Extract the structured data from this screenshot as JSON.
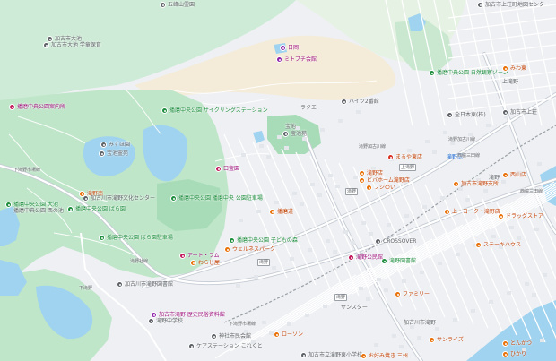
{
  "map": {
    "colors": {
      "park": "#b7e4c7",
      "forest": "#cdebd6",
      "water": "#9fd3f0",
      "urban": "#f1f3f4",
      "road": "#ffffff",
      "major_road": "#c3ccd6",
      "land_beige": "#f4ecd9"
    },
    "labels": [
      {
        "text": "五峰山霊園",
        "color": "gray",
        "pin": "gray"
      },
      {
        "text": "加古市上荘町地図センター",
        "color": "gray",
        "pin": "gray"
      },
      {
        "text": "加古市大池",
        "color": "gray",
        "pin": "gray"
      },
      {
        "text": "加古市大池 学童保育",
        "color": "gray",
        "pin": "gray"
      },
      {
        "text": "日岡",
        "color": "pink",
        "pin": "purple"
      },
      {
        "text": "ミトブチ会館",
        "color": "pink",
        "pin": "purple"
      },
      {
        "text": "播磨中央公園 自然観察ゾーン",
        "color": "green",
        "pin": "green"
      },
      {
        "text": "みわ東",
        "color": "orange",
        "pin": "orange"
      },
      {
        "text": "上滝野",
        "color": "gray",
        "pin": null
      },
      {
        "text": "播磨中央公園案内所",
        "color": "pink",
        "pin": "pink"
      },
      {
        "text": "播磨中央公園 サイクリングステーション",
        "color": "green",
        "pin": "green"
      },
      {
        "text": "ハイツ2番館",
        "color": "gray",
        "pin": "gray"
      },
      {
        "text": "ラクエ",
        "color": "gray",
        "pin": null
      },
      {
        "text": "全日本東(株)",
        "color": "gray",
        "pin": "gray"
      },
      {
        "text": "加古市上荘",
        "color": "gray",
        "pin": "gray"
      },
      {
        "text": "宝池",
        "color": "gray",
        "pin": null
      },
      {
        "text": "宝池苑",
        "color": "gray",
        "pin": "gray"
      },
      {
        "text": "宝池霊苑",
        "color": "gray",
        "pin": "gray"
      },
      {
        "text": "みずほ園",
        "color": "gray",
        "pin": "gray"
      },
      {
        "text": "口宝園",
        "color": "pink",
        "pin": "pink"
      },
      {
        "text": "滝野",
        "color": "gray",
        "pin": null
      },
      {
        "text": "まるや東店",
        "color": "orange",
        "pin": "red"
      },
      {
        "text": "滝野駅",
        "color": "blue",
        "pin": null
      },
      {
        "text": "滝野店",
        "color": "orange",
        "pin": "orange"
      },
      {
        "text": "ビバホーム滝野店",
        "color": "orange",
        "pin": "orange"
      },
      {
        "text": "加古市滝野支所",
        "color": "orange",
        "pin": "orange"
      },
      {
        "text": "フジのい",
        "color": "orange",
        "pin": "orange"
      },
      {
        "text": "西山店",
        "color": "orange",
        "pin": "orange"
      },
      {
        "text": "ドラッグストア",
        "color": "orange",
        "pin": "orange"
      },
      {
        "text": "上・ヨーク・滝野店",
        "color": "orange",
        "pin": "orange"
      },
      {
        "text": "播磨中央公園 播磨中央 公園駐車場",
        "color": "green",
        "pin": "green"
      },
      {
        "text": "播磨中央公園 大池",
        "color": "green",
        "pin": "green"
      },
      {
        "text": "播磨中央公園 西の池",
        "color": "gray",
        "pin": null
      },
      {
        "text": "播磨中央公園 ばら園",
        "color": "green",
        "pin": "green"
      },
      {
        "text": "播磨中央公園 ばら園駐車場",
        "color": "green",
        "pin": "green"
      },
      {
        "text": "播磨中央公園 子どもの森",
        "color": "green",
        "pin": "green"
      },
      {
        "text": "滝野南",
        "color": "orange",
        "pin": "orange"
      },
      {
        "text": "加古川市滝野文化センター",
        "color": "gray",
        "pin": "gray"
      },
      {
        "text": "加古川市滝野図書館",
        "color": "gray",
        "pin": "gray"
      },
      {
        "text": "アート・ラム",
        "color": "pink",
        "pin": "pink"
      },
      {
        "text": "わらじ屋",
        "color": "orange",
        "pin": "orange"
      },
      {
        "text": "滝野中学校",
        "color": "gray",
        "pin": "gray"
      },
      {
        "text": "滝野図書館",
        "color": "green",
        "pin": "green"
      },
      {
        "text": "CROSSOVER",
        "color": "gray",
        "pin": "gray"
      },
      {
        "text": "滝野公民館",
        "color": "pink",
        "pin": "pink"
      },
      {
        "text": "加古市滝野 歴史民俗資料館",
        "color": "pink",
        "pin": "purple"
      },
      {
        "text": "ウェルネスパーク",
        "color": "orange",
        "pin": "orange"
      },
      {
        "text": "播磨道",
        "color": "orange",
        "pin": "orange"
      },
      {
        "text": "サンスター",
        "color": "gray",
        "pin": null
      },
      {
        "text": "ローソン",
        "color": "orange",
        "pin": "orange"
      },
      {
        "text": "ファミリー",
        "color": "orange",
        "pin": "orange"
      },
      {
        "text": "サンライズ",
        "color": "orange",
        "pin": "orange"
      },
      {
        "text": "ケアステーション これくと",
        "color": "gray",
        "pin": "gray"
      },
      {
        "text": "加古市立滝野東小学校",
        "color": "gray",
        "pin": "gray"
      },
      {
        "text": "お好み焼き 三州",
        "color": "orange",
        "pin": "orange"
      },
      {
        "text": "神社市民会館",
        "color": "gray",
        "pin": "gray"
      },
      {
        "text": "加古川市滝野",
        "color": "gray",
        "pin": null
      },
      {
        "text": "ひかり",
        "color": "orange",
        "pin": "orange"
      },
      {
        "text": "ステーキハウス",
        "color": "orange",
        "pin": "orange"
      },
      {
        "text": "とんかつ",
        "color": "orange",
        "pin": "orange"
      }
    ],
    "road_labels": [
      {
        "text": "滝野加古川線"
      },
      {
        "text": "西脇三田線"
      },
      {
        "text": "滝野社線"
      },
      {
        "text": "下滝野市場線"
      },
      {
        "text": "下滝野市場線"
      },
      {
        "text": "西脇三田線"
      },
      {
        "text": "滝野加古川線"
      },
      {
        "text": "下滝野"
      }
    ],
    "junctions": [
      {
        "text": "上滝野"
      },
      {
        "text": "滝野"
      },
      {
        "text": "滝野"
      },
      {
        "text": "滝野"
      }
    ]
  }
}
